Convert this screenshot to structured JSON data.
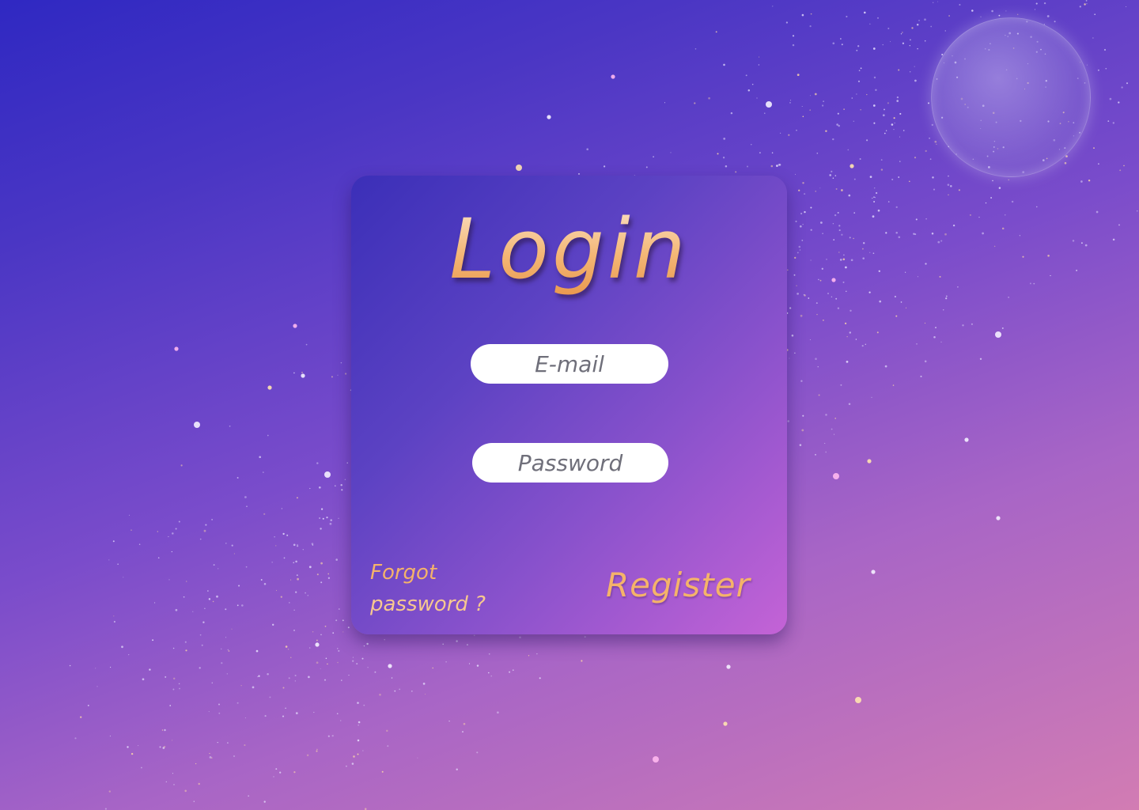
{
  "login": {
    "title": "Login",
    "email_placeholder": "E-mail",
    "password_placeholder": "Password",
    "forgot_line1": "Forgot",
    "forgot_line2": "password ?",
    "register_label": "Register"
  },
  "colors": {
    "background_top": "#2f28c2",
    "background_bottom": "#d27cb3",
    "card_start": "#3b2fb8",
    "card_end": "#c463d6",
    "accent": "#f5b36a",
    "input_bg": "#ffffff",
    "placeholder": "#6f6f7a"
  },
  "decor": {
    "background_icon": "starfield",
    "moon_icon": "moon"
  }
}
